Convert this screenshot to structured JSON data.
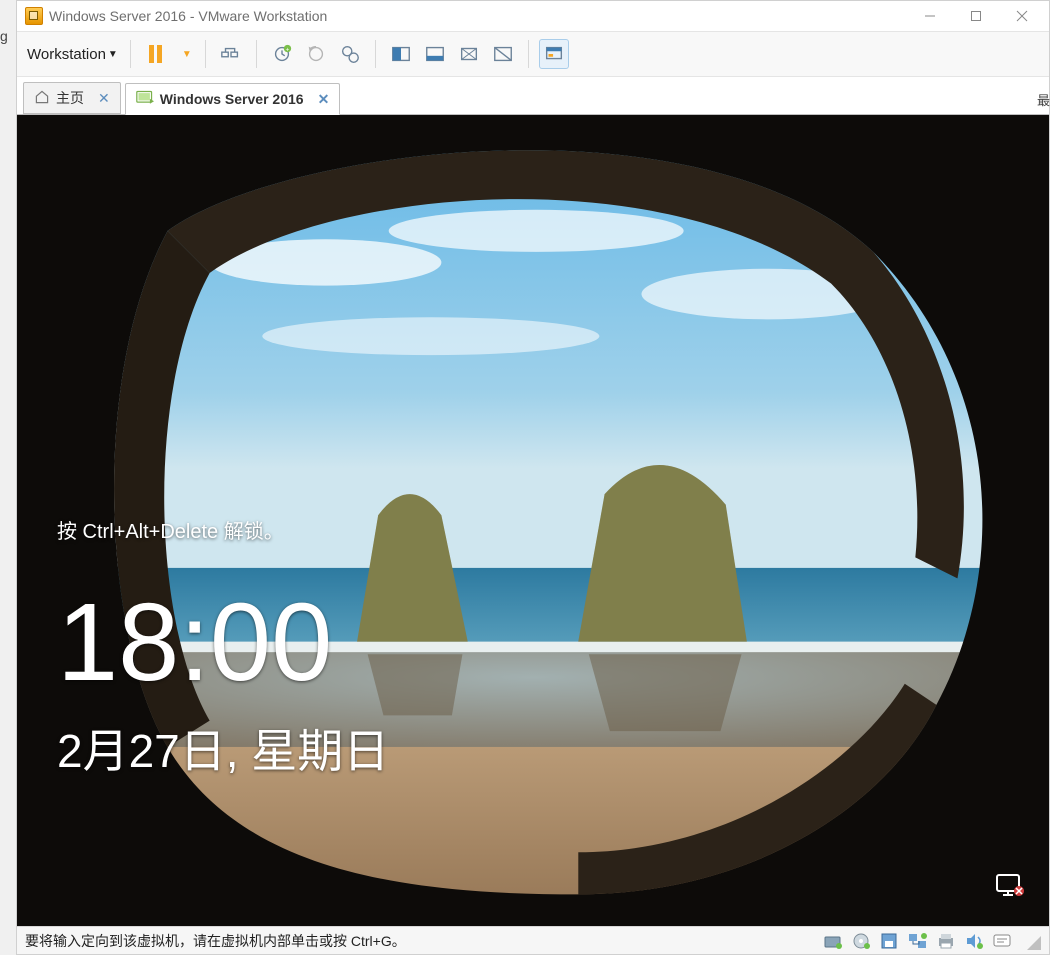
{
  "left_gutter_char": "g",
  "right_gutter_char": "最",
  "titlebar": {
    "title": "Windows Server 2016 - VMware Workstation"
  },
  "toolbar": {
    "menu_label": "Workstation"
  },
  "tabs": {
    "home_label": "主页",
    "vm_label": "Windows Server 2016"
  },
  "lockscreen": {
    "unlock_hint": "按 Ctrl+Alt+Delete 解锁。",
    "time": "18:00",
    "date": "2月27日, 星期日"
  },
  "statusbar": {
    "hint": "要将输入定向到该虚拟机，请在虚拟机内部单击或按 Ctrl+G。"
  }
}
